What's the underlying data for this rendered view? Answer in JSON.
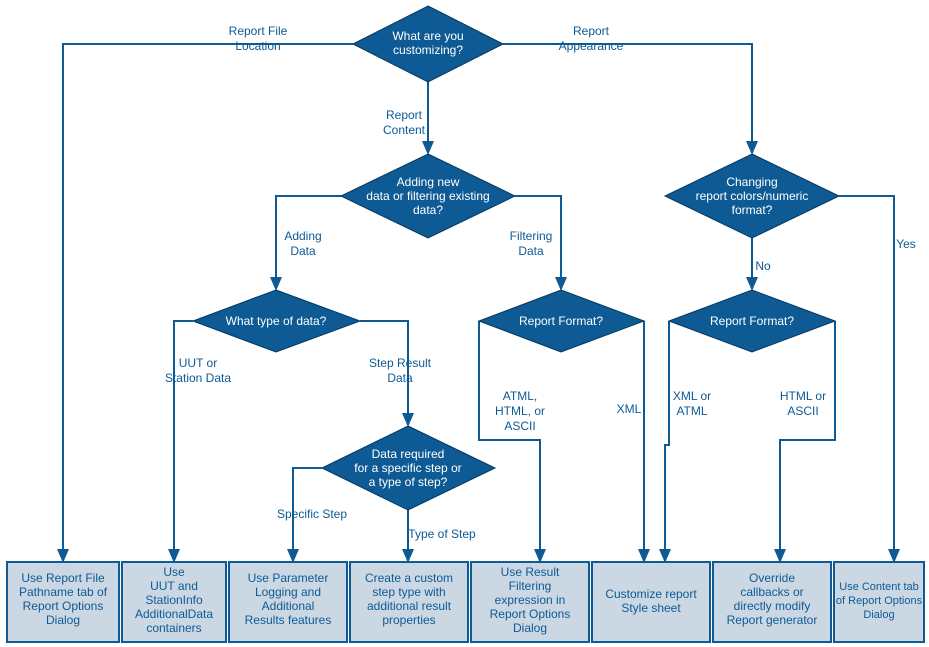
{
  "decisions": {
    "root": {
      "l1": "What are you",
      "l2": "customizing?"
    },
    "addFilt": {
      "l1": "Adding new",
      "l2": "data or filtering existing",
      "l3": "data?"
    },
    "colors": {
      "l1": "Changing",
      "l2": "report colors/numeric",
      "l3": "format?"
    },
    "dtype": {
      "l1": "What type of data?"
    },
    "rfmt1": {
      "l1": "Report Format?"
    },
    "rfmt2": {
      "l1": "Report Format?"
    },
    "reqstep": {
      "l1": "Data required",
      "l2": "for a specific step or",
      "l3": "a type of step?"
    }
  },
  "edges": {
    "fileLoc": {
      "l1": "Report File",
      "l2": "Location"
    },
    "appear": {
      "l1": "Report",
      "l2": "Appearance"
    },
    "content": {
      "l1": "Report",
      "l2": "Content"
    },
    "adding": {
      "l1": "Adding",
      "l2": "Data"
    },
    "filtering": {
      "l1": "Filtering",
      "l2": "Data"
    },
    "no": {
      "l1": "No"
    },
    "yes": {
      "l1": "Yes"
    },
    "uut": {
      "l1": "UUT or",
      "l2": "Station Data"
    },
    "stepres": {
      "l1": "Step Result",
      "l2": "Data"
    },
    "atml": {
      "l1": "ATML,",
      "l2": "HTML, or",
      "l3": "ASCII"
    },
    "xml": {
      "l1": "XML"
    },
    "xmlatml": {
      "l1": "XML or",
      "l2": "ATML"
    },
    "htmlascii": {
      "l1": "HTML or",
      "l2": "ASCII"
    },
    "specific": {
      "l1": "Specific Step"
    },
    "typeof": {
      "l1": "Type of Step"
    }
  },
  "boxes": {
    "b1": {
      "l1": "Use Report File",
      "l2": "Pathname tab of",
      "l3": "Report Options",
      "l4": "Dialog"
    },
    "b2": {
      "l1": "Use",
      "l2": "UUT and",
      "l3": "StationInfo",
      "l4": "AdditionalData",
      "l5": "containers"
    },
    "b3": {
      "l1": "Use Parameter",
      "l2": "Logging and",
      "l3": "Additional",
      "l4": "Results features"
    },
    "b4": {
      "l1": "Create a custom",
      "l2": "step type with",
      "l3": "additional result",
      "l4": "properties"
    },
    "b5": {
      "l1": "Use Result",
      "l2": "Filtering",
      "l3": "expression in",
      "l4": "Report Options",
      "l5": "Dialog"
    },
    "b6": {
      "l1": "Customize report",
      "l2": "Style sheet"
    },
    "b7": {
      "l1": "Override",
      "l2": "callbacks or",
      "l3": "directly modify",
      "l4": "Report generator"
    },
    "b8": {
      "l1": "Use Content tab",
      "l2": "of Report Options",
      "l3": "Dialog"
    }
  }
}
